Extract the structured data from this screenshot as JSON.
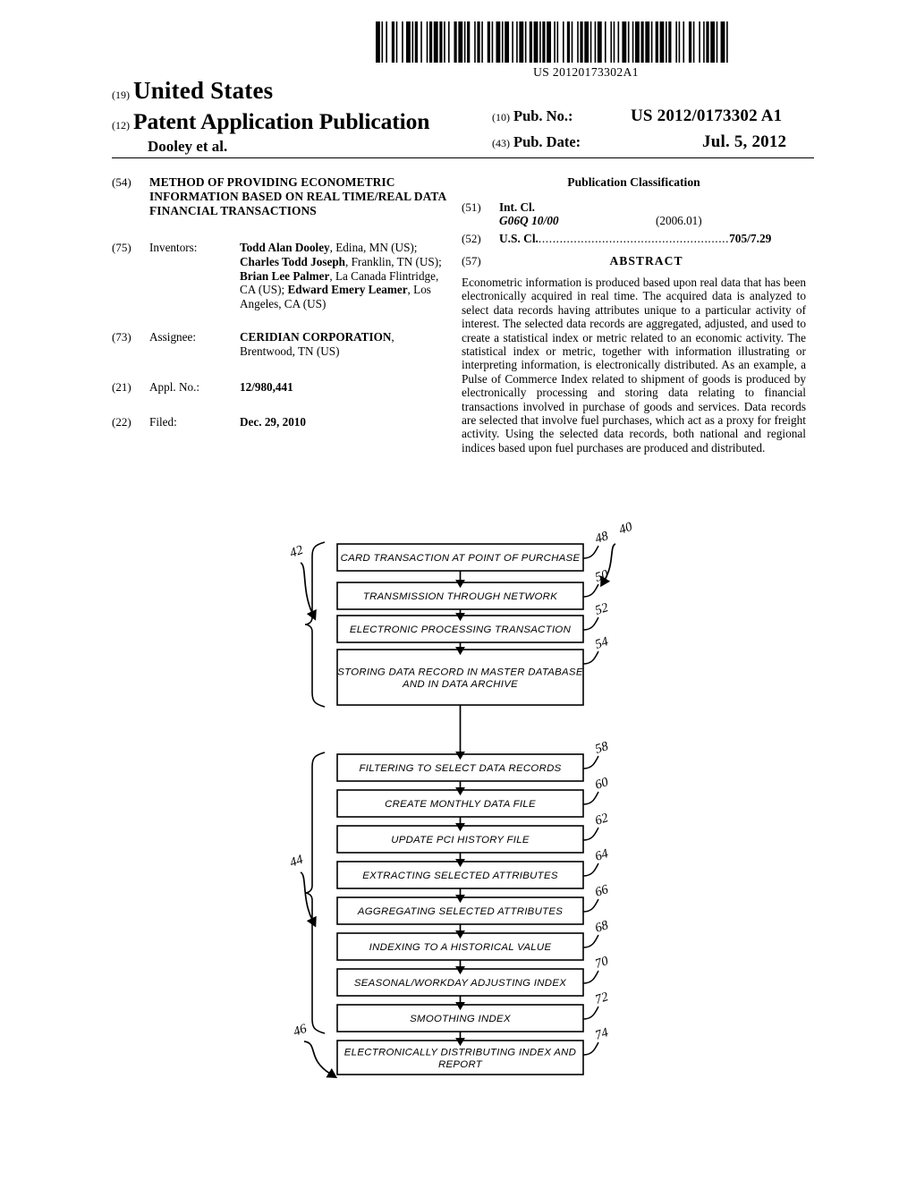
{
  "barcode": {
    "publication_number_text": "US 20120173302A1"
  },
  "header": {
    "code_19": "(19)",
    "country": "United States",
    "code_12": "(12)",
    "doc_type": "Patent Application Publication",
    "applicant_short": "Dooley et al.",
    "code_10": "(10)",
    "pub_no_label": "Pub. No.:",
    "pub_no_value": "US 2012/0173302 A1",
    "code_43": "(43)",
    "pub_date_label": "Pub. Date:",
    "pub_date_value": "Jul. 5, 2012"
  },
  "left_column": {
    "title_code": "(54)",
    "title": "METHOD OF PROVIDING ECONOMETRIC INFORMATION BASED ON REAL TIME/REAL DATA FINANCIAL TRANSACTIONS",
    "inventors_code": "(75)",
    "inventors_label": "Inventors:",
    "inventors": [
      {
        "name": "Todd Alan Dooley",
        "location": ", Edina, MN (US); "
      },
      {
        "name": "Charles Todd Joseph",
        "location": ", Franklin, TN (US); "
      },
      {
        "name": "Brian Lee Palmer",
        "location": ", La Canada Flintridge, CA (US); "
      },
      {
        "name": "Edward Emery Leamer",
        "location": ", Los Angeles, CA (US)"
      }
    ],
    "assignee_code": "(73)",
    "assignee_label": "Assignee:",
    "assignee_name": "CERIDIAN CORPORATION",
    "assignee_location": ", Brentwood, TN (US)",
    "appl_no_code": "(21)",
    "appl_no_label": "Appl. No.:",
    "appl_no_value": "12/980,441",
    "filed_code": "(22)",
    "filed_label": "Filed:",
    "filed_value": "Dec. 29, 2010"
  },
  "right_column": {
    "classification_heading": "Publication Classification",
    "int_cl_code": "(51)",
    "int_cl_label": "Int. Cl.",
    "int_cl_value": "G06Q 10/00",
    "int_cl_version": "(2006.01)",
    "us_cl_code": "(52)",
    "us_cl_label": "U.S. Cl.",
    "us_cl_dots": "......................................................",
    "us_cl_value": "705/7.29",
    "abstract_code": "(57)",
    "abstract_heading": "ABSTRACT",
    "abstract_text": "Econometric information is produced based upon real data that has been electronically acquired in real time. The acquired data is analyzed to select data records having attributes unique to a particular activity of interest. The selected data records are aggregated, adjusted, and used to create a statistical index or metric related to an economic activity. The statistical index or metric, together with infor­mation illustrating or interpreting information, is electroni­cally distributed. As an example, a Pulse of Commerce Index related to shipment of goods is produced by electronically processing and storing data relating to financial transactions involved in purchase of goods and services. Data records are selected that involve fuel purchases, which act as a proxy for freight activity. Using the selected data records, both national and regional indices based upon fuel purchases are produced and distributed."
  },
  "figure": {
    "reference_40": "40",
    "bracket_42": "42",
    "bracket_44": "44",
    "bracket_46": "46",
    "boxes": [
      {
        "num": "48",
        "lines": [
          "CARD TRANSACTION AT POINT OF PURCHASE"
        ]
      },
      {
        "num": "50",
        "lines": [
          "TRANSMISSION THROUGH NETWORK"
        ]
      },
      {
        "num": "52",
        "lines": [
          "ELECTRONIC PROCESSING TRANSACTION"
        ]
      },
      {
        "num": "54",
        "lines": [
          "STORING DATA RECORD IN MASTER DATABASE",
          "AND IN DATA ARCHIVE"
        ]
      },
      {
        "num": "58",
        "lines": [
          "FILTERING TO SELECT DATA RECORDS"
        ]
      },
      {
        "num": "60",
        "lines": [
          "CREATE MONTHLY DATA FILE"
        ]
      },
      {
        "num": "62",
        "lines": [
          "UPDATE PCI HISTORY FILE"
        ]
      },
      {
        "num": "64",
        "lines": [
          "EXTRACTING SELECTED ATTRIBUTES"
        ]
      },
      {
        "num": "66",
        "lines": [
          "AGGREGATING SELECTED ATTRIBUTES"
        ]
      },
      {
        "num": "68",
        "lines": [
          "INDEXING TO A HISTORICAL VALUE"
        ]
      },
      {
        "num": "70",
        "lines": [
          "SEASONAL/WORKDAY ADJUSTING INDEX"
        ]
      },
      {
        "num": "72",
        "lines": [
          "SMOOTHING INDEX"
        ]
      },
      {
        "num": "74",
        "lines": [
          "ELECTRONICALLY DISTRIBUTING INDEX AND",
          "REPORT"
        ]
      }
    ]
  }
}
